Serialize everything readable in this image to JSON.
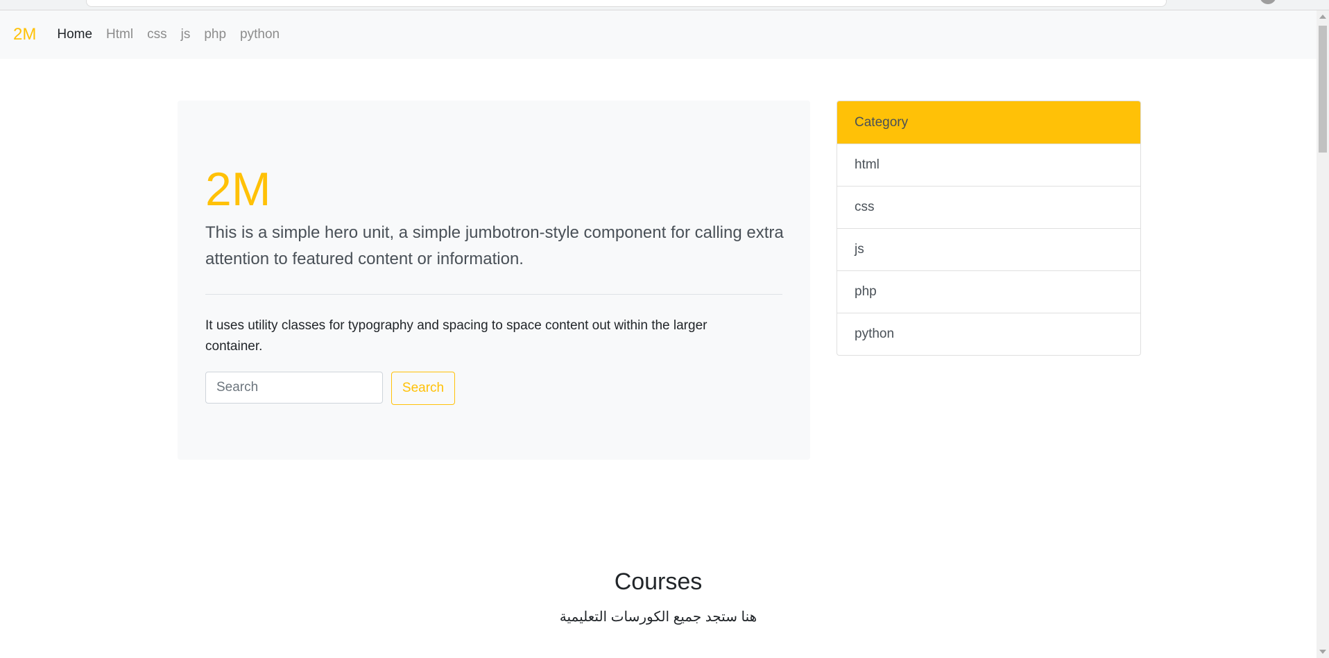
{
  "navbar": {
    "brand": "2M",
    "links": [
      {
        "label": "Home",
        "active": true
      },
      {
        "label": "Html",
        "active": false
      },
      {
        "label": "css",
        "active": false
      },
      {
        "label": "js",
        "active": false
      },
      {
        "label": "php",
        "active": false
      },
      {
        "label": "python",
        "active": false
      }
    ]
  },
  "hero": {
    "title": "2M",
    "lead": "This is a simple hero unit, a simple jumbotron-style component for calling extra attention to featured content or information.",
    "text": "It uses utility classes for typography and spacing to space content out within the larger container.",
    "search": {
      "placeholder": "Search",
      "value": "",
      "button_label": "Search"
    }
  },
  "sidebar": {
    "header": "Category",
    "items": [
      {
        "label": "html"
      },
      {
        "label": "css"
      },
      {
        "label": "js"
      },
      {
        "label": "php"
      },
      {
        "label": "python"
      }
    ]
  },
  "courses": {
    "title": "Courses",
    "subtitle": "هنا ستجد جميع الكورسات التعليمية"
  },
  "colors": {
    "accent": "#ffc107",
    "navbar_bg": "#f8f9fa",
    "muted_link": "#8c8c8c"
  }
}
